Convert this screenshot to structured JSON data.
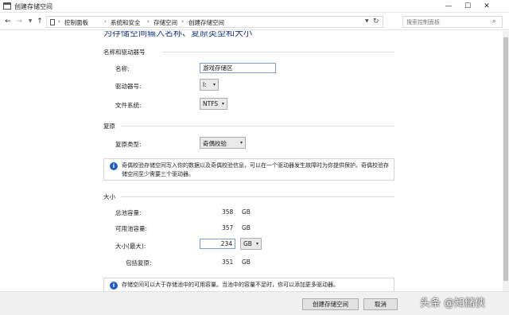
{
  "window": {
    "title": "创建存储空间",
    "min": "—",
    "max": "☐",
    "close": "✕"
  },
  "nav": {
    "back": "←",
    "forward": "→",
    "up": "↑",
    "breadcrumbs": [
      "控制面板",
      "系统和安全",
      "存储空间",
      "创建存储空间"
    ],
    "search_placeholder": "搜索控制面板"
  },
  "heading": "为存储空间输入名称、复原类型和大小",
  "name_section": {
    "label": "名称和驱动器号",
    "name_label": "名称:",
    "name_value": "游戏存储区",
    "drive_label": "驱动器号:",
    "drive_value": "I:",
    "fs_label": "文件系统:",
    "fs_value": "NTFS"
  },
  "resiliency": {
    "label": "复原",
    "type_label": "复原类型:",
    "type_value": "奇偶校验",
    "info": "奇偶校验存储空间写入你的数据以及奇偶校验信息，可以在一个驱动器发生故障时为你提供保护。奇偶校验存储空间至少需要三个驱动器。"
  },
  "size": {
    "label": "大小",
    "total_label": "总池容量:",
    "total_value": "358",
    "total_unit": "GB",
    "available_label": "可用池容量:",
    "available_value": "357",
    "available_unit": "GB",
    "max_label": "大小(最大):",
    "max_value": "234",
    "max_unit": "GB",
    "including_label": "包括复原:",
    "including_value": "351",
    "including_unit": "GB",
    "info": "存储空间可以大于存储池中的可用容量。当池中的容量不足时，你可以添加更多驱动器。"
  },
  "footer": {
    "create": "创建存储空间",
    "cancel": "取消"
  },
  "watermark": "头条 @知储侠"
}
